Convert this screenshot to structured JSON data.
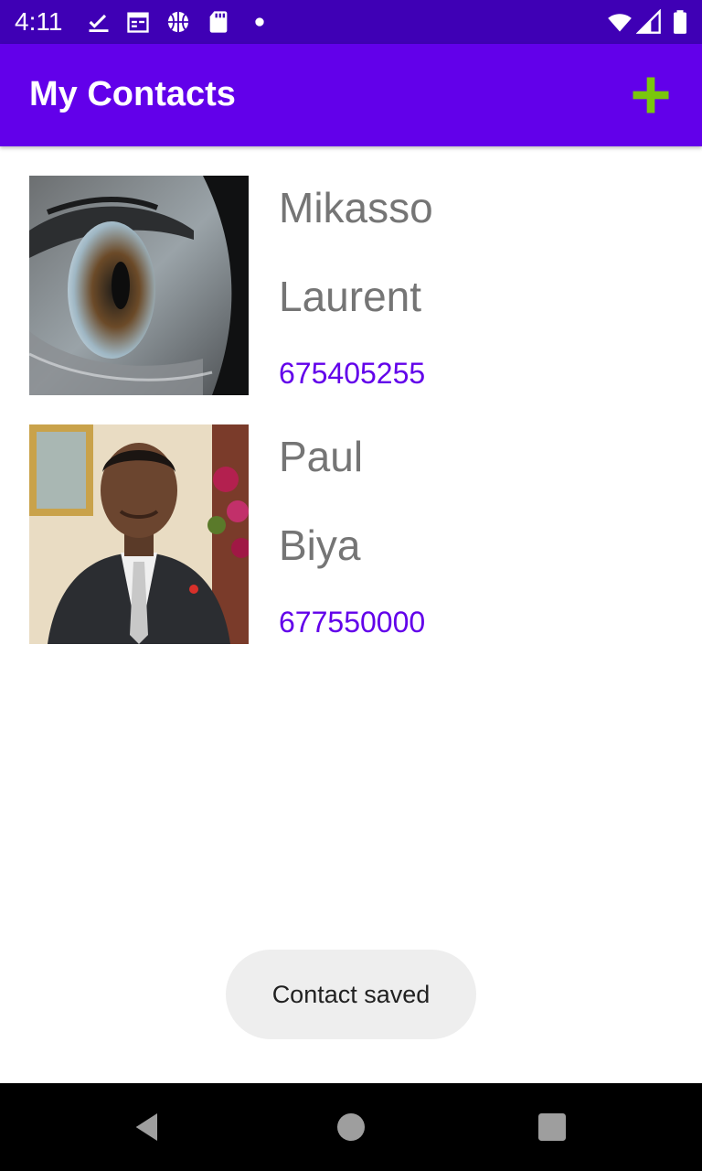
{
  "status_bar": {
    "time": "4:11",
    "icons_left": [
      "check-download-icon",
      "calendar-icon",
      "basketball-icon",
      "sd-card-icon",
      "dot-icon"
    ],
    "icons_right": [
      "wifi-icon",
      "signal-icon",
      "battery-icon"
    ]
  },
  "app_bar": {
    "title": "My Contacts",
    "add_icon": "plus-icon",
    "add_icon_color": "#7ac70c"
  },
  "contacts": [
    {
      "first_name": "Mikasso",
      "last_name": "Laurent",
      "phone": "675405255",
      "photo": "eye-closeup-photo"
    },
    {
      "first_name": "Paul",
      "last_name": "Biya",
      "phone": "677550000",
      "photo": "man-in-suit-photo"
    }
  ],
  "toast": {
    "message": "Contact saved"
  },
  "nav_bar": {
    "buttons": [
      "back-icon",
      "home-icon",
      "recents-icon"
    ]
  },
  "colors": {
    "status_bar": "#3f00b5",
    "app_bar": "#6200ea",
    "name_text": "#757575",
    "phone_text": "#6200ea",
    "toast_bg": "#eeeeee"
  }
}
